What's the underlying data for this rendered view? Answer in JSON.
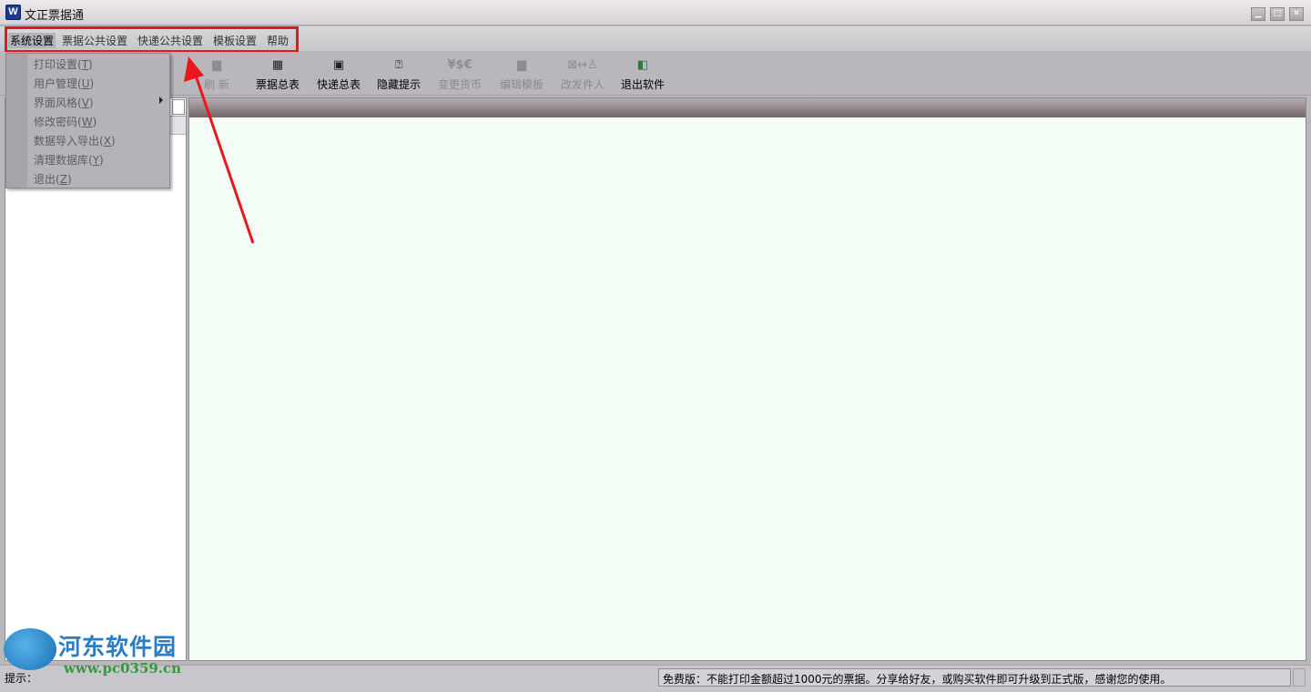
{
  "window": {
    "app_icon_letter": "W",
    "title": "文正票据通",
    "minimize_icon": "minimize-icon",
    "maximize_icon": "maximize-icon",
    "close_icon": "close-icon"
  },
  "menubar": {
    "items": [
      "系统设置",
      "票据公共设置",
      "快递公共设置",
      "模板设置",
      "帮助"
    ],
    "active_index": 0
  },
  "dropdown": {
    "items": [
      {
        "label": "打印设置",
        "key": "T"
      },
      {
        "label": "用户管理",
        "key": "U"
      },
      {
        "label": "界面风格",
        "key": "V",
        "submenu": true
      },
      {
        "label": "修改密码",
        "key": "W"
      },
      {
        "label": "数据导入导出",
        "key": "X"
      },
      {
        "label": "清理数据库",
        "key": "Y"
      },
      {
        "label": "退出",
        "key": "Z"
      }
    ]
  },
  "toolbar": {
    "buttons": [
      {
        "label": "刷 新",
        "icon": "page-icon",
        "enabled": false
      },
      {
        "label": "票据总表",
        "icon": "table-icon",
        "enabled": true
      },
      {
        "label": "快递总表",
        "icon": "grid-icon",
        "enabled": true
      },
      {
        "label": "隐藏提示",
        "icon": "help-icon",
        "enabled": true
      },
      {
        "label": "变更货币",
        "icon": "currency-icon",
        "glyph": "¥$€",
        "enabled": false
      },
      {
        "label": "编辑模板",
        "icon": "template-icon",
        "enabled": false
      },
      {
        "label": "改发件人",
        "icon": "swap-sender-icon",
        "enabled": false
      },
      {
        "label": "退出软件",
        "icon": "exit-door-icon",
        "enabled": true
      }
    ]
  },
  "statusbar": {
    "left_text": "提示：",
    "right_text": "免费版：不能打印金额超过1000元的票据。分享给好友，或购买软件即可升级到正式版，感谢您的使用。"
  },
  "watermark": {
    "brand": "河东软件园",
    "url": "www.pc0359.cn"
  },
  "colors": {
    "highlight_box": "#e8171d",
    "main_panel_bg": "#f3fcf5",
    "main_header": "#726469"
  }
}
